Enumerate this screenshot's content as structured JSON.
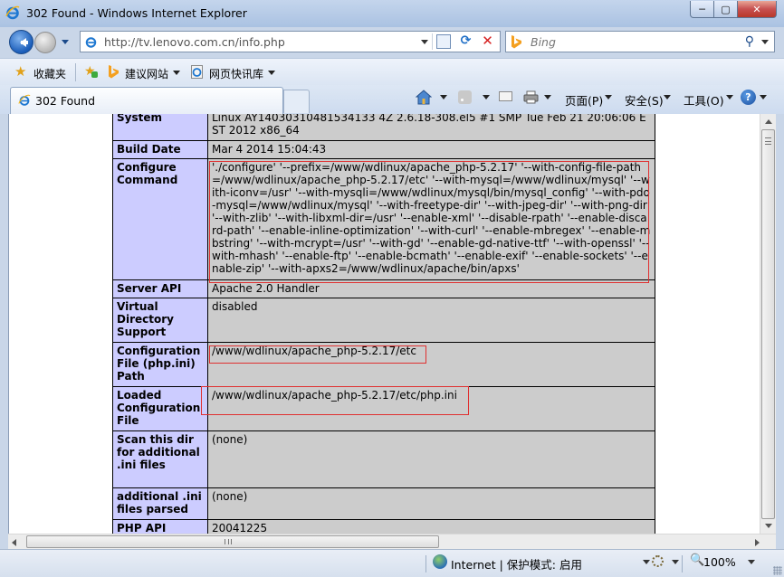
{
  "window": {
    "title": "302 Found - Windows Internet Explorer",
    "controls": {
      "minimize": "─",
      "maximize": "▢",
      "close": "✕"
    }
  },
  "address_bar": {
    "url": "http://tv.lenovo.com.cn/info.php",
    "search_placeholder": "Bing",
    "search_icon": "magnifier-icon"
  },
  "favorites_bar": {
    "favorites_label": "收藏夹",
    "items": [
      {
        "label": "建议网站",
        "icon": "bing-icon"
      },
      {
        "label": "网页快讯库",
        "icon": "web-slice-icon"
      }
    ]
  },
  "tabs": [
    {
      "label": "302 Found",
      "active": true
    }
  ],
  "command_bar": {
    "page": "页面(P)",
    "safety": "安全(S)",
    "tools": "工具(O)",
    "help_glyph": "?"
  },
  "phpinfo": {
    "rows": [
      {
        "key": "System",
        "value": "Linux AY14030310481534133 4Z 2.6.18-308.el5 #1 SMP Tue Feb 21 20:06:06 EST 2012 x86_64"
      },
      {
        "key": "Build Date",
        "value": "Mar 4 2014 15:04:43"
      },
      {
        "key": "Configure Command",
        "value": "'./configure' '--prefix=/www/wdlinux/apache_php-5.2.17' '--with-config-file-path=/www/wdlinux/apache_php-5.2.17/etc' '--with-mysql=/www/wdlinux/mysql' '--with-iconv=/usr' '--with-mysqli=/www/wdlinux/mysql/bin/mysql_config' '--with-pdo-mysql=/www/wdlinux/mysql' '--with-freetype-dir' '--with-jpeg-dir' '--with-png-dir' '--with-zlib' '--with-libxml-dir=/usr' '--enable-xml' '--disable-rpath' '--enable-discard-path' '--enable-inline-optimization' '--with-curl' '--enable-mbregex' '--enable-mbstring' '--with-mcrypt=/usr' '--with-gd' '--enable-gd-native-ttf' '--with-openssl' '--with-mhash' '--enable-ftp' '--enable-bcmath' '--enable-exif' '--enable-sockets' '--enable-zip' '--with-apxs2=/www/wdlinux/apache/bin/apxs'"
      },
      {
        "key": "Server API",
        "value": "Apache 2.0 Handler"
      },
      {
        "key": "Virtual Directory Support",
        "value": "disabled"
      },
      {
        "key": "Configuration File (php.ini) Path",
        "value": "/www/wdlinux/apache_php-5.2.17/etc"
      },
      {
        "key": "Loaded Configuration File",
        "value": "/www/wdlinux/apache_php-5.2.17/etc/php.ini"
      },
      {
        "key": "Scan this dir for additional .ini files",
        "value": "(none)"
      },
      {
        "key": "additional .ini files parsed",
        "value": "(none)"
      },
      {
        "key": "PHP API",
        "value": "20041225"
      }
    ]
  },
  "status_bar": {
    "zone": "Internet | 保护模式: 启用",
    "zoom": "100%",
    "zoom_icon": "🔍"
  },
  "colors": {
    "php_key_bg": "#ccccff",
    "php_value_bg": "#cccccc",
    "highlight_box": "#e03030",
    "chrome_blue": "#c4d5ec"
  }
}
